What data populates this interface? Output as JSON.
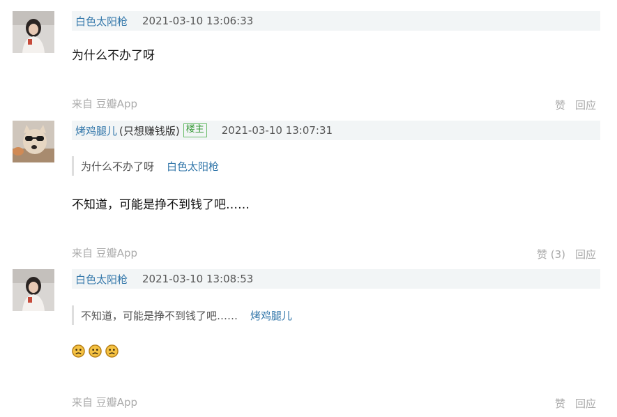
{
  "comments": [
    {
      "author": "白色太阳枪",
      "time": "2021-03-10 13:06:33",
      "text": "为什么不办了呀",
      "source": "来自 豆瓣App",
      "like_label": "赞",
      "reply_label": "回应"
    },
    {
      "author": "烤鸡腿儿",
      "author_note": "(只想赚钱版)",
      "badge": "楼主",
      "time": "2021-03-10 13:07:31",
      "quote_text": "为什么不办了呀",
      "quote_author": "白色太阳枪",
      "text": "不知道，可能是挣不到钱了吧……",
      "source": "来自 豆瓣App",
      "like_label": "赞 (3)",
      "reply_label": "回应"
    },
    {
      "author": "白色太阳枪",
      "time": "2021-03-10 13:08:53",
      "quote_text": "不知道，可能是挣不到钱了吧……",
      "quote_author": "烤鸡腿儿",
      "emojis": [
        "sad-face-icon",
        "sad-face-icon",
        "sad-face-icon"
      ],
      "source": "来自 豆瓣App",
      "like_label": "赞",
      "reply_label": "回应"
    }
  ],
  "colors": {
    "link": "#3377aa",
    "header_bg": "#f2f5f6",
    "muted": "#aaaaaa",
    "badge_green": "#3a9b3a"
  }
}
